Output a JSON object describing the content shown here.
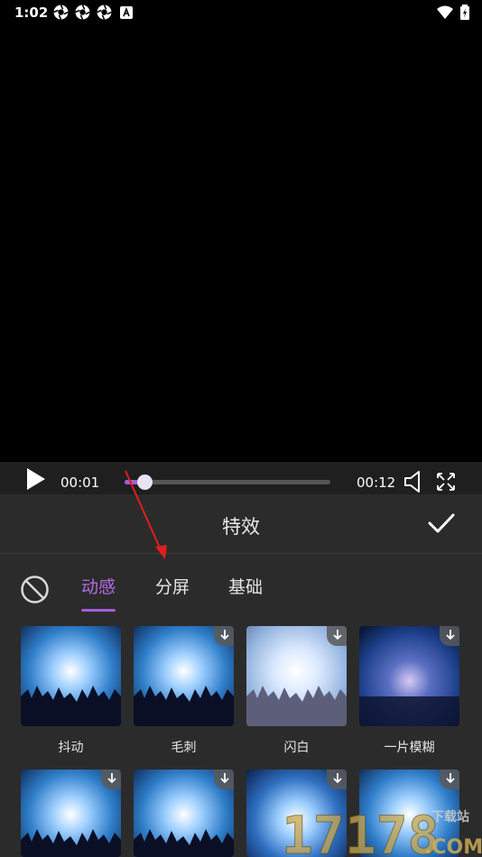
{
  "status_bar": {
    "time": "1:02"
  },
  "player": {
    "current_time": "00:01",
    "total_time": "00:12",
    "progress": 0.1
  },
  "panel": {
    "title": "特效",
    "tabs": [
      {
        "label": "动感",
        "active": true
      },
      {
        "label": "分屏",
        "active": false
      },
      {
        "label": "基础",
        "active": false
      }
    ],
    "effects": [
      {
        "label": "抖动",
        "downloadable": false
      },
      {
        "label": "毛刺",
        "downloadable": true
      },
      {
        "label": "闪白",
        "downloadable": true
      },
      {
        "label": "一片模糊",
        "downloadable": true
      }
    ],
    "effects_row2": [
      {
        "downloadable": true
      },
      {
        "downloadable": true
      },
      {
        "downloadable": true
      },
      {
        "downloadable": true
      }
    ]
  },
  "watermark": {
    "text": "17178",
    "domain": ".COM",
    "site": "下载站"
  },
  "colors": {
    "accent": "#b66be6",
    "panel_bg": "#2b2b2b",
    "annotation_arrow": "#e01e1e"
  }
}
